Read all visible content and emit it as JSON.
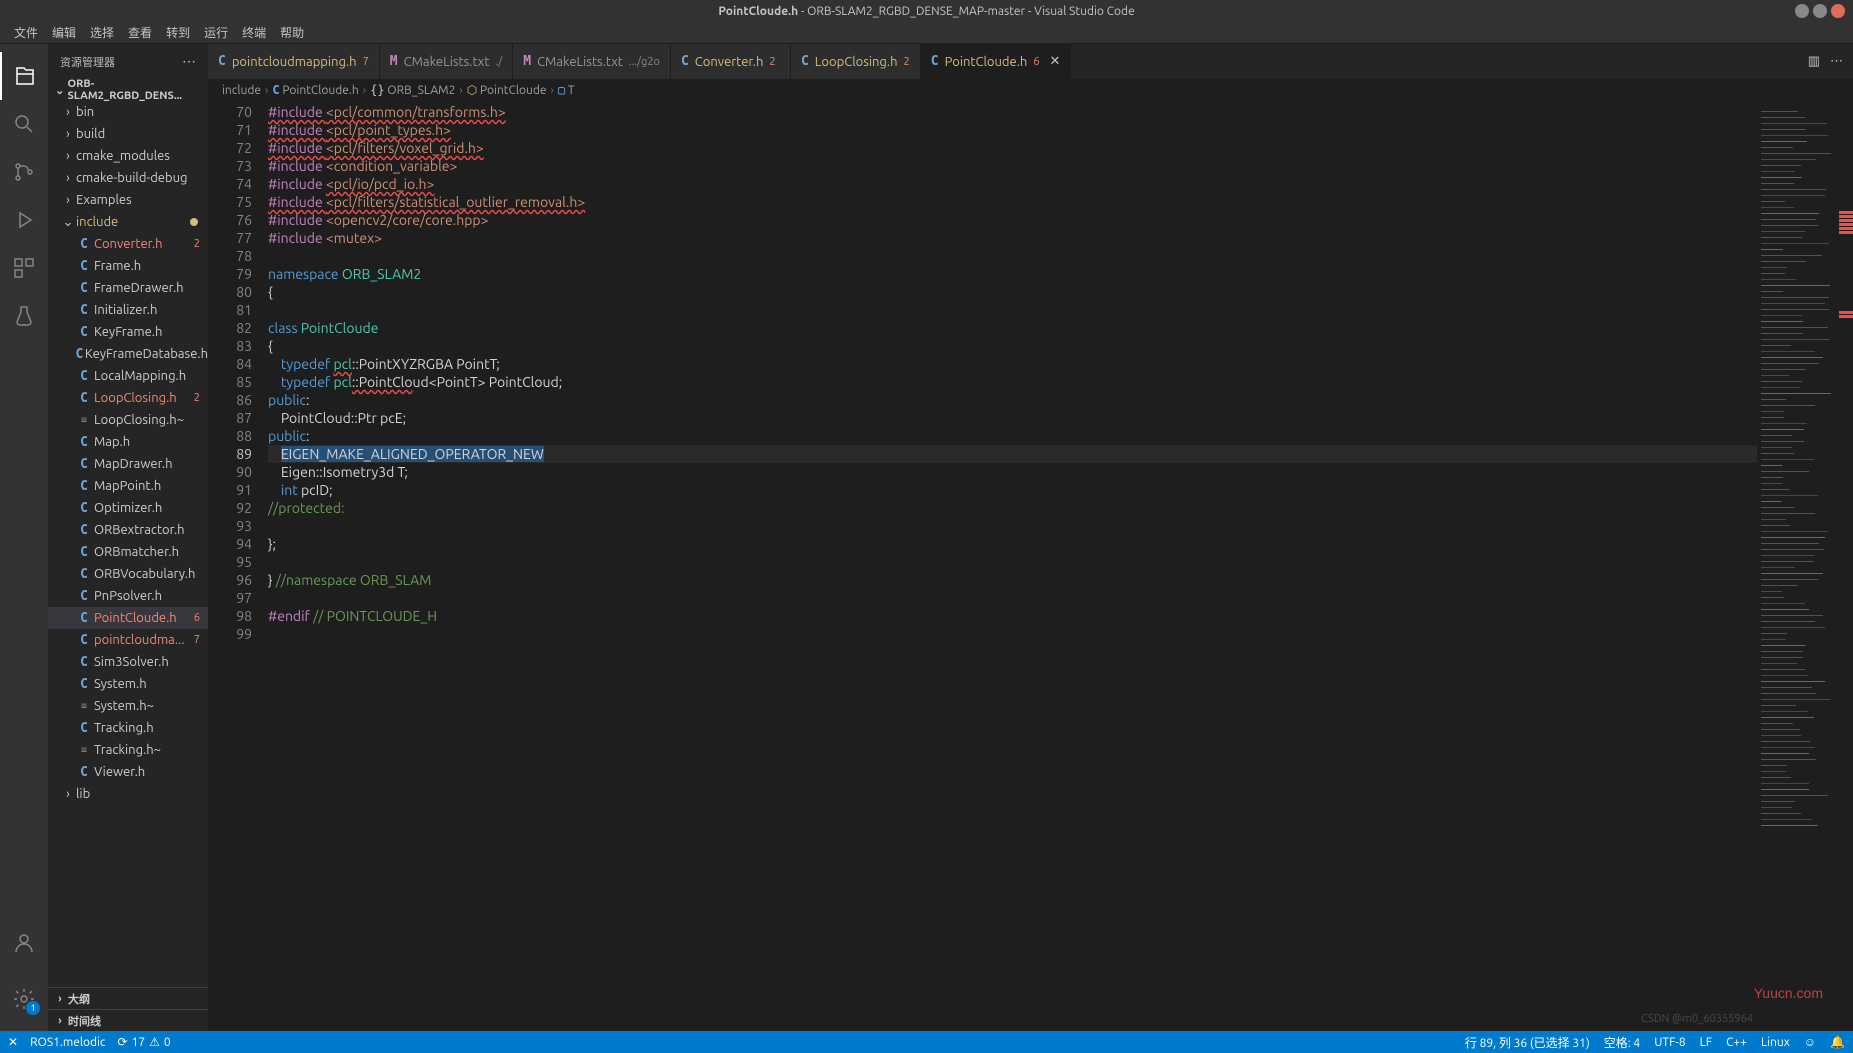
{
  "title": {
    "file": "PointCloude.h",
    "project": "ORB-SLAM2_RGBD_DENSE_MAP-master",
    "app": "Visual Studio Code"
  },
  "menu": [
    "文件",
    "编辑",
    "选择",
    "查看",
    "转到",
    "运行",
    "终端",
    "帮助"
  ],
  "sidebar": {
    "title": "资源管理器",
    "root": "ORB-SLAM2_RGBD_DENS...",
    "items": [
      {
        "type": "folder",
        "name": "bin",
        "depth": 1
      },
      {
        "type": "folder",
        "name": "build",
        "depth": 1
      },
      {
        "type": "folder",
        "name": "cmake_modules",
        "depth": 1
      },
      {
        "type": "folder",
        "name": "cmake-build-debug",
        "depth": 1
      },
      {
        "type": "folder",
        "name": "Examples",
        "depth": 1
      },
      {
        "type": "folder",
        "name": "include",
        "depth": 1,
        "open": true,
        "modified": true
      },
      {
        "type": "file",
        "icon": "C",
        "name": "Converter.h",
        "depth": 2,
        "error": true,
        "badge": "2"
      },
      {
        "type": "file",
        "icon": "C",
        "name": "Frame.h",
        "depth": 2
      },
      {
        "type": "file",
        "icon": "C",
        "name": "FrameDrawer.h",
        "depth": 2
      },
      {
        "type": "file",
        "icon": "C",
        "name": "Initializer.h",
        "depth": 2
      },
      {
        "type": "file",
        "icon": "C",
        "name": "KeyFrame.h",
        "depth": 2
      },
      {
        "type": "file",
        "icon": "C",
        "name": "KeyFrameDatabase.h",
        "depth": 2
      },
      {
        "type": "file",
        "icon": "C",
        "name": "LocalMapping.h",
        "depth": 2
      },
      {
        "type": "file",
        "icon": "C",
        "name": "LoopClosing.h",
        "depth": 2,
        "error": true,
        "badge": "2"
      },
      {
        "type": "file",
        "icon": "≡",
        "name": "LoopClosing.h~",
        "depth": 2
      },
      {
        "type": "file",
        "icon": "C",
        "name": "Map.h",
        "depth": 2
      },
      {
        "type": "file",
        "icon": "C",
        "name": "MapDrawer.h",
        "depth": 2
      },
      {
        "type": "file",
        "icon": "C",
        "name": "MapPoint.h",
        "depth": 2
      },
      {
        "type": "file",
        "icon": "C",
        "name": "Optimizer.h",
        "depth": 2
      },
      {
        "type": "file",
        "icon": "C",
        "name": "ORBextractor.h",
        "depth": 2
      },
      {
        "type": "file",
        "icon": "C",
        "name": "ORBmatcher.h",
        "depth": 2
      },
      {
        "type": "file",
        "icon": "C",
        "name": "ORBVocabulary.h",
        "depth": 2
      },
      {
        "type": "file",
        "icon": "C",
        "name": "PnPsolver.h",
        "depth": 2
      },
      {
        "type": "file",
        "icon": "C",
        "name": "PointCloude.h",
        "depth": 2,
        "error": true,
        "badge": "6",
        "active": true
      },
      {
        "type": "file",
        "icon": "C",
        "name": "pointcloudma...",
        "depth": 2,
        "error": true,
        "badge": "7"
      },
      {
        "type": "file",
        "icon": "C",
        "name": "Sim3Solver.h",
        "depth": 2
      },
      {
        "type": "file",
        "icon": "C",
        "name": "System.h",
        "depth": 2
      },
      {
        "type": "file",
        "icon": "≡",
        "name": "System.h~",
        "depth": 2
      },
      {
        "type": "file",
        "icon": "C",
        "name": "Tracking.h",
        "depth": 2
      },
      {
        "type": "file",
        "icon": "≡",
        "name": "Tracking.h~",
        "depth": 2
      },
      {
        "type": "file",
        "icon": "C",
        "name": "Viewer.h",
        "depth": 2
      },
      {
        "type": "folder",
        "name": "lib",
        "depth": 1
      }
    ],
    "sections": [
      "大纲",
      "时间线"
    ]
  },
  "tabs": [
    {
      "icon": "C",
      "label": "pointcloudmapping.h",
      "badge": "7",
      "modified": true
    },
    {
      "icon": "M",
      "label": "CMakeLists.txt",
      "desc": "./"
    },
    {
      "icon": "M",
      "label": "CMakeLists.txt",
      "desc": ".../g2o"
    },
    {
      "icon": "C",
      "label": "Converter.h",
      "badge": "2",
      "modified": true
    },
    {
      "icon": "C",
      "label": "LoopClosing.h",
      "badge": "2",
      "modified": true
    },
    {
      "icon": "C",
      "label": "PointCloude.h",
      "badge": "6",
      "modified": true,
      "active": true,
      "close": true
    }
  ],
  "breadcrumbs": [
    {
      "text": "include"
    },
    {
      "icon": "C",
      "text": "PointCloude.h"
    },
    {
      "icon": "{}",
      "text": "ORB_SLAM2"
    },
    {
      "icon": "⬡",
      "text": "PointCloude"
    },
    {
      "icon": "▢",
      "text": "T"
    }
  ],
  "code": {
    "start": 70,
    "current": 89,
    "lines": [
      [
        {
          "c": "pp",
          "t": "#include ",
          "err": true
        },
        {
          "c": "str",
          "t": "<pcl/common/transforms.h>",
          "err": true
        }
      ],
      [
        {
          "c": "pp",
          "t": "#include ",
          "err": true
        },
        {
          "c": "str",
          "t": "<pcl/point_types.h>",
          "err": true
        }
      ],
      [
        {
          "c": "pp",
          "t": "#include ",
          "err": true
        },
        {
          "c": "str",
          "t": "<pcl/filters/voxel_grid.h>",
          "err": true
        }
      ],
      [
        {
          "c": "pp",
          "t": "#include "
        },
        {
          "c": "str",
          "t": "<condition_variable>"
        }
      ],
      [
        {
          "c": "pp",
          "t": "#include "
        },
        {
          "c": "str",
          "t": "<pcl/io/pcd_io.h>",
          "err": true
        }
      ],
      [
        {
          "c": "pp",
          "t": "#include ",
          "err": true
        },
        {
          "c": "str",
          "t": "<pcl/filters/statistical_outlier_removal.h>",
          "err": true
        }
      ],
      [
        {
          "c": "pp",
          "t": "#include "
        },
        {
          "c": "str",
          "t": "<opencv2/core/core.hpp>"
        }
      ],
      [
        {
          "c": "pp",
          "t": "#include "
        },
        {
          "c": "str",
          "t": "<mutex>"
        }
      ],
      [],
      [
        {
          "c": "kw",
          "t": "namespace "
        },
        {
          "c": "type",
          "t": "ORB_SLAM2"
        }
      ],
      [
        {
          "c": "id",
          "t": "{"
        }
      ],
      [],
      [
        {
          "c": "kw",
          "t": "class "
        },
        {
          "c": "type",
          "t": "PointCloude"
        }
      ],
      [
        {
          "c": "id",
          "t": "{"
        }
      ],
      [
        {
          "c": "id",
          "t": "    "
        },
        {
          "c": "kw",
          "t": "typedef "
        },
        {
          "c": "type",
          "t": "pcl",
          "err": true
        },
        {
          "c": "id",
          "t": "::PointXYZRGBA PointT;"
        }
      ],
      [
        {
          "c": "id",
          "t": "    "
        },
        {
          "c": "kw",
          "t": "typedef "
        },
        {
          "c": "type",
          "t": "pcl"
        },
        {
          "c": "id",
          "t": "::PointClo",
          "err": true
        },
        {
          "c": "id",
          "t": "ud<PointT> PointCloud;"
        }
      ],
      [
        {
          "c": "kw",
          "t": "public"
        },
        {
          "c": "id",
          "t": ":"
        }
      ],
      [
        {
          "c": "id",
          "t": "    PointCloud::Ptr pcE;"
        }
      ],
      [
        {
          "c": "kw",
          "t": "public"
        },
        {
          "c": "id",
          "t": ":"
        }
      ],
      [
        {
          "c": "id",
          "t": "    "
        },
        {
          "c": "id",
          "t": "EIGEN_MAKE_ALIGNED_OPERATOR_NEW",
          "sel": true
        }
      ],
      [
        {
          "c": "id",
          "t": "    Eigen::Isometry3d T;"
        }
      ],
      [
        {
          "c": "id",
          "t": "    "
        },
        {
          "c": "kw",
          "t": "int"
        },
        {
          "c": "id",
          "t": " pcID;"
        }
      ],
      [
        {
          "c": "cmt",
          "t": "//protected:"
        }
      ],
      [],
      [
        {
          "c": "id",
          "t": "};"
        }
      ],
      [],
      [
        {
          "c": "id",
          "t": "} "
        },
        {
          "c": "cmt",
          "t": "//namespace ORB_SLAM"
        }
      ],
      [],
      [
        {
          "c": "pp",
          "t": "#endif "
        },
        {
          "c": "cmt",
          "t": "// POINTCLOUDE_H"
        }
      ],
      []
    ]
  },
  "status": {
    "remote": "✕",
    "ros": "ROS1.melodic",
    "sync": "⟳",
    "errors": "17",
    "warnings": "0",
    "cursor": "行 89, 列 36 (已选择 31)",
    "spaces": "空格: 4",
    "encoding": "UTF-8",
    "eol": "LF",
    "lang": "C++",
    "os": "Linux",
    "feedback": "☺",
    "bell": "🔔"
  },
  "activity_badge": "1",
  "watermark": "Yuucn.com",
  "watermark2": "CSDN @m0_60355964"
}
